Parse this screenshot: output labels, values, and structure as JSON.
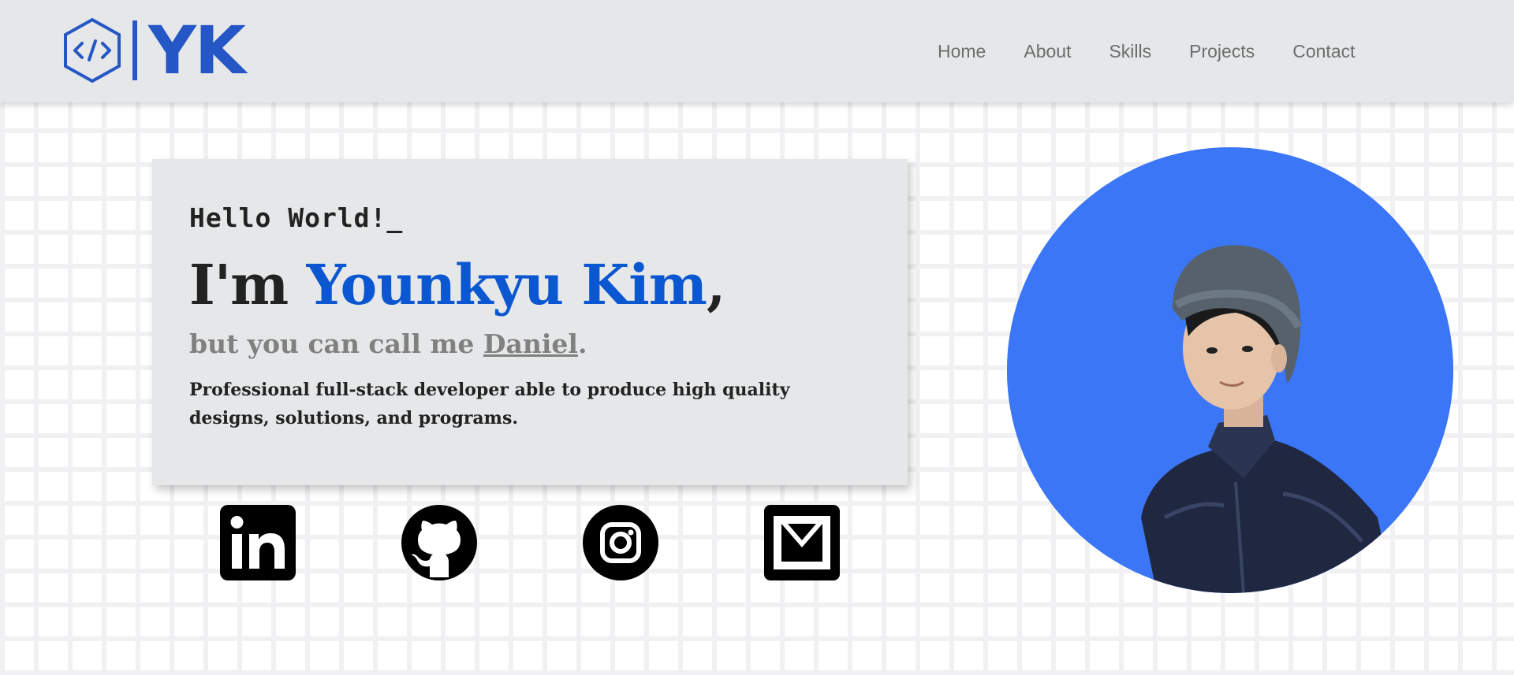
{
  "colors": {
    "accent": "#0a57d1",
    "logo": "#2457c5",
    "nav_bg": "#e5e7e9",
    "portrait_bg": "#3b76f6"
  },
  "header": {
    "logo_icon": "code-hexagon-icon",
    "logo_text": "YK",
    "nav": [
      {
        "label": "Home"
      },
      {
        "label": "About"
      },
      {
        "label": "Skills"
      },
      {
        "label": "Projects"
      },
      {
        "label": "Contact"
      }
    ]
  },
  "hero": {
    "greeting": "Hello World!_",
    "intro_prefix": "I'm ",
    "name": "Younkyu Kim",
    "intro_suffix": ",",
    "sub_prefix": "but you can call me ",
    "nickname": "Daniel",
    "sub_suffix": ".",
    "description": "Professional full-stack developer able to produce high quality designs, solutions, and programs."
  },
  "socials": [
    {
      "icon": "linkedin-icon"
    },
    {
      "icon": "github-icon"
    },
    {
      "icon": "instagram-icon"
    },
    {
      "icon": "email-icon"
    }
  ],
  "portrait": {
    "icon": "profile-photo"
  }
}
